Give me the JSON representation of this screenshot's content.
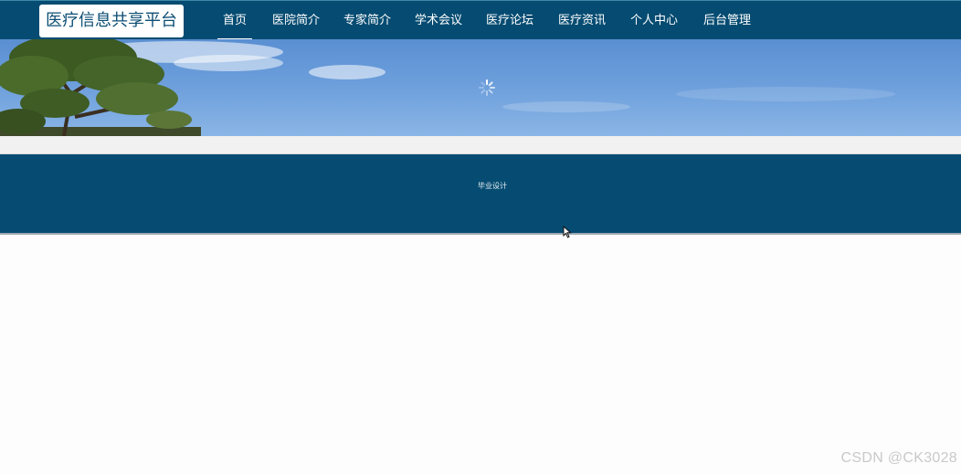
{
  "header": {
    "logo_text": "医疗信息共享平台",
    "nav_items": [
      {
        "label": "首页",
        "active": true
      },
      {
        "label": "医院简介",
        "active": false
      },
      {
        "label": "专家简介",
        "active": false
      },
      {
        "label": "学术会议",
        "active": false
      },
      {
        "label": "医疗论坛",
        "active": false
      },
      {
        "label": "医疗资讯",
        "active": false
      },
      {
        "label": "个人中心",
        "active": false
      },
      {
        "label": "后台管理",
        "active": false
      }
    ]
  },
  "footer": {
    "text": "毕业设计"
  },
  "watermark": "CSDN @CK3028",
  "colors": {
    "primary": "#064c72",
    "banner_sky": "#6c9edb",
    "background": "#fdfdfd"
  }
}
